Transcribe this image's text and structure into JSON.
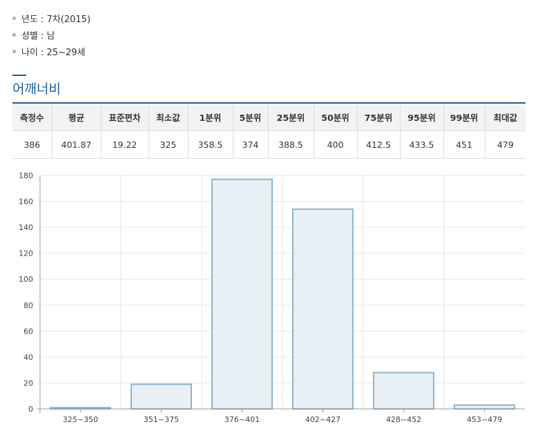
{
  "info": [
    {
      "label": "년도 : 7차(2015)"
    },
    {
      "label": "성별 : 남"
    },
    {
      "label": "나이 : 25~29세"
    }
  ],
  "section_title": "어깨너비",
  "stats": {
    "headers": [
      "측정수",
      "평균",
      "표준편차",
      "최소값",
      "1분위",
      "5분위",
      "25분위",
      "50분위",
      "75분위",
      "95분위",
      "99분위",
      "최대값"
    ],
    "values": [
      "386",
      "401.87",
      "19.22",
      "325",
      "358.5",
      "374",
      "388.5",
      "400",
      "412.5",
      "433.5",
      "451",
      "479"
    ]
  },
  "chart_data": {
    "type": "bar",
    "categories": [
      "325~350",
      "351~375",
      "376~401",
      "402~427",
      "428~452",
      "453~479"
    ],
    "values": [
      1,
      19,
      177,
      154,
      28,
      3
    ],
    "ylim": [
      0,
      180
    ],
    "yticks": [
      0,
      20,
      40,
      60,
      80,
      100,
      120,
      140,
      160,
      180
    ],
    "grid": true,
    "bar_fill": "#e8f0f5",
    "bar_stroke": "#8fb4cc"
  }
}
